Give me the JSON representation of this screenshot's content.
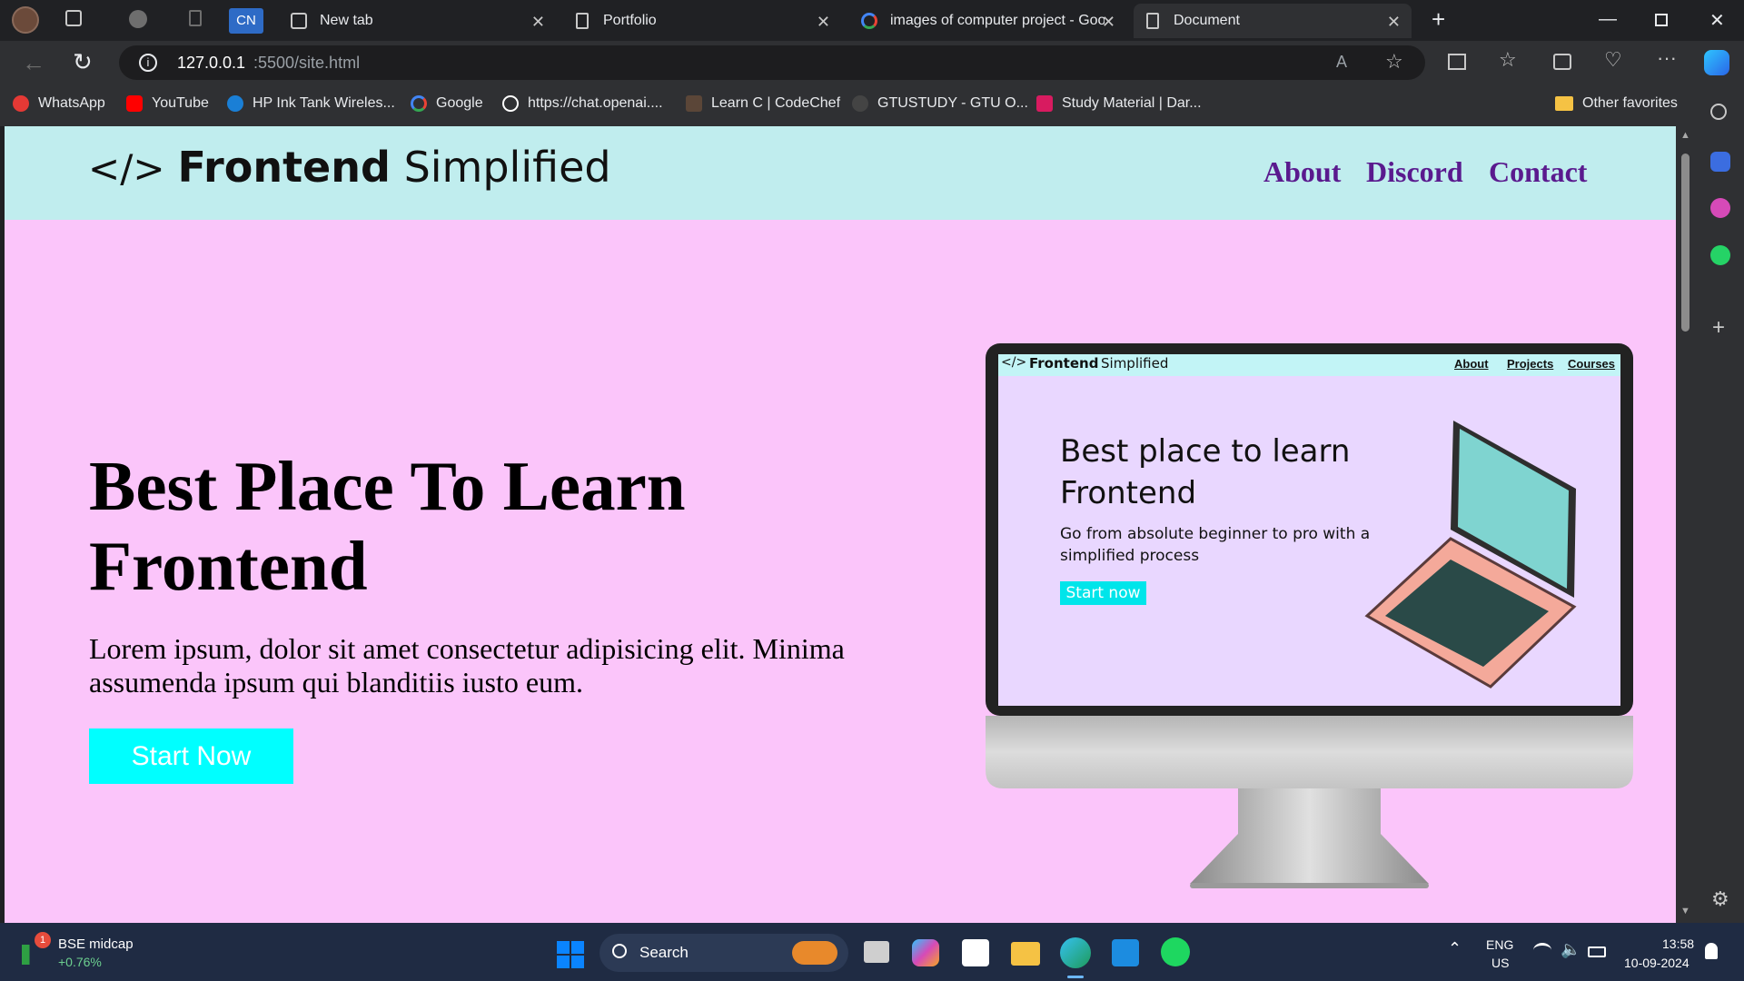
{
  "browser": {
    "tabs": [
      {
        "label": "CN"
      },
      {
        "label": "New tab"
      },
      {
        "label": "Portfolio"
      },
      {
        "label": "images of computer project - Goo"
      },
      {
        "label": "Document"
      }
    ],
    "url_host": "127.0.0.1",
    "url_path": ":5500/site.html",
    "bookmarks": [
      "WhatsApp",
      "YouTube",
      "HP Ink Tank Wireles...",
      "Google",
      "https://chat.openai....",
      "Learn C | CodeChef",
      "GTUSTUDY - GTU O...",
      "Study Material | Dar..."
    ],
    "other_favorites": "Other favorites"
  },
  "site": {
    "logo_bold": "Frontend",
    "logo_light": "Simplified",
    "logo_symbol": "</>",
    "nav": [
      "About",
      "Discord",
      "Contact"
    ],
    "hero_title_line1": "Best Place To Learn",
    "hero_title_line2": "Frontend",
    "hero_text": "Lorem ipsum, dolor sit amet consectetur adipisicing elit. Minima assumenda ipsum qui blanditiis iusto eum.",
    "cta": "Start Now",
    "colors": {
      "header_bg": "#c0edee",
      "page_bg": "#fbc5fa",
      "nav": "#5a1a8e",
      "cta": "#00ffff"
    }
  },
  "monitor_screen": {
    "logo_bold": "Frontend",
    "logo_light": "Simplified",
    "nav": [
      "About",
      "Projects",
      "Courses"
    ],
    "headline_line1": "Best place to learn",
    "headline_line2": "Frontend",
    "subline_1": "Go from absolute beginner to pro with a",
    "subline_2": "simplified process",
    "button": "Start now"
  },
  "taskbar": {
    "widget_title": "BSE midcap",
    "widget_value": "+0.76%",
    "widget_badge": "1",
    "search": "Search",
    "lang_1": "ENG",
    "lang_2": "US",
    "time": "13:58",
    "date": "10-09-2024"
  }
}
